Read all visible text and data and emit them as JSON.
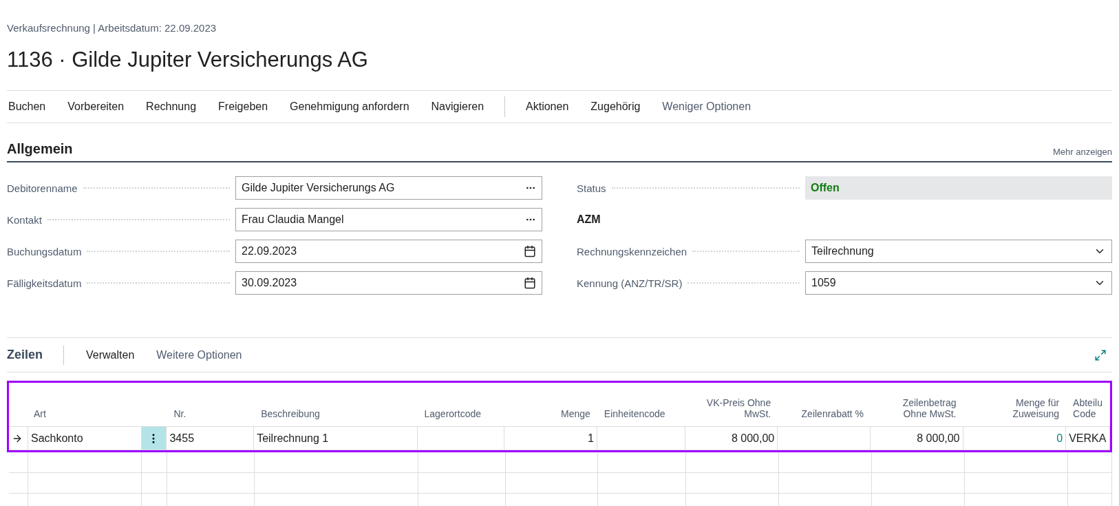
{
  "header": {
    "breadcrumb": "Verkaufsrechnung | Arbeitsdatum: 22.09.2023",
    "title": "1136 · Gilde Jupiter Versicherungs AG"
  },
  "actions": {
    "primary": [
      "Buchen",
      "Vorbereiten",
      "Rechnung",
      "Freigeben",
      "Genehmigung anfordern",
      "Navigieren"
    ],
    "secondary": [
      "Aktionen",
      "Zugehörig"
    ],
    "toggle": "Weniger Optionen"
  },
  "general": {
    "title": "Allgemein",
    "more": "Mehr anzeigen",
    "left": [
      {
        "kind": "lookup",
        "label": "Debitorenname",
        "value": "Gilde Jupiter Versicherungs AG"
      },
      {
        "kind": "lookup",
        "label": "Kontakt",
        "value": "Frau Claudia Mangel"
      },
      {
        "kind": "date",
        "label": "Buchungsdatum",
        "value": "22.09.2023"
      },
      {
        "kind": "date",
        "label": "Fälligkeitsdatum",
        "value": "30.09.2023"
      }
    ],
    "right": [
      {
        "kind": "status",
        "label": "Status",
        "value": "Offen"
      },
      {
        "kind": "heading",
        "label": "AZM"
      },
      {
        "kind": "select",
        "label": "Rechnungskennzeichen",
        "value": "Teilrechnung"
      },
      {
        "kind": "select",
        "label": "Kennung (ANZ/TR/SR)",
        "value": "1059"
      }
    ]
  },
  "lines": {
    "title": "Zeilen",
    "actions": [
      "Verwalten",
      "Weitere Optionen"
    ],
    "columns": [
      {
        "label": "Art",
        "kind": "text"
      },
      {
        "label": "Nr.",
        "kind": "text"
      },
      {
        "label": "Beschreibung",
        "kind": "text"
      },
      {
        "label": "Lagerortcode",
        "kind": "text"
      },
      {
        "label": "Menge",
        "kind": "number"
      },
      {
        "label": "Einheitencode",
        "kind": "text"
      },
      {
        "label": "VK-Preis Ohne MwSt.",
        "kind": "number"
      },
      {
        "label": "Zeilenrabatt %",
        "kind": "number"
      },
      {
        "label": "Zeilenbetrag Ohne MwSt.",
        "kind": "number"
      },
      {
        "label": "Menge für Zuweisung",
        "kind": "link"
      },
      {
        "label": "Abteilu Code",
        "kind": "text"
      }
    ],
    "rows": [
      {
        "selected": true,
        "cells": [
          "Sachkonto",
          "3455",
          "Teilrechnung 1",
          "",
          "1",
          "",
          "8 000,00",
          "",
          "8 000,00",
          "0",
          "VERKA"
        ]
      }
    ]
  }
}
